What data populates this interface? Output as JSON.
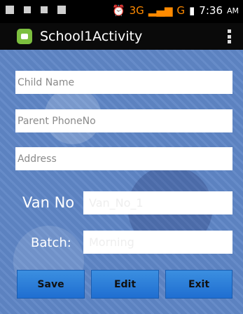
{
  "status_bar": {
    "network": "3G",
    "network_signal": "G",
    "time": "7:36",
    "ampm": "AM",
    "icons": [
      "message-icon",
      "usb-icon",
      "lock-icon",
      "notification-icon",
      "alarm-icon",
      "signal-icon",
      "battery-icon"
    ]
  },
  "action_bar": {
    "title": "School1Activity",
    "app_icon": "android-app-icon",
    "overflow_icon": "overflow-menu-icon"
  },
  "form": {
    "child_name_placeholder": "Child Name",
    "parent_phone_placeholder": "Parent PhoneNo",
    "address_placeholder": "Address",
    "van_label": "Van No",
    "van_value": "Van_No_1",
    "batch_label": "Batch:",
    "batch_value": "Morning"
  },
  "buttons": {
    "save": "Save",
    "edit": "Edit",
    "exit": "Exit"
  },
  "colors": {
    "background": "#5f86c6",
    "button": "#2d7fdc",
    "network_accent": "#ff8a00"
  }
}
